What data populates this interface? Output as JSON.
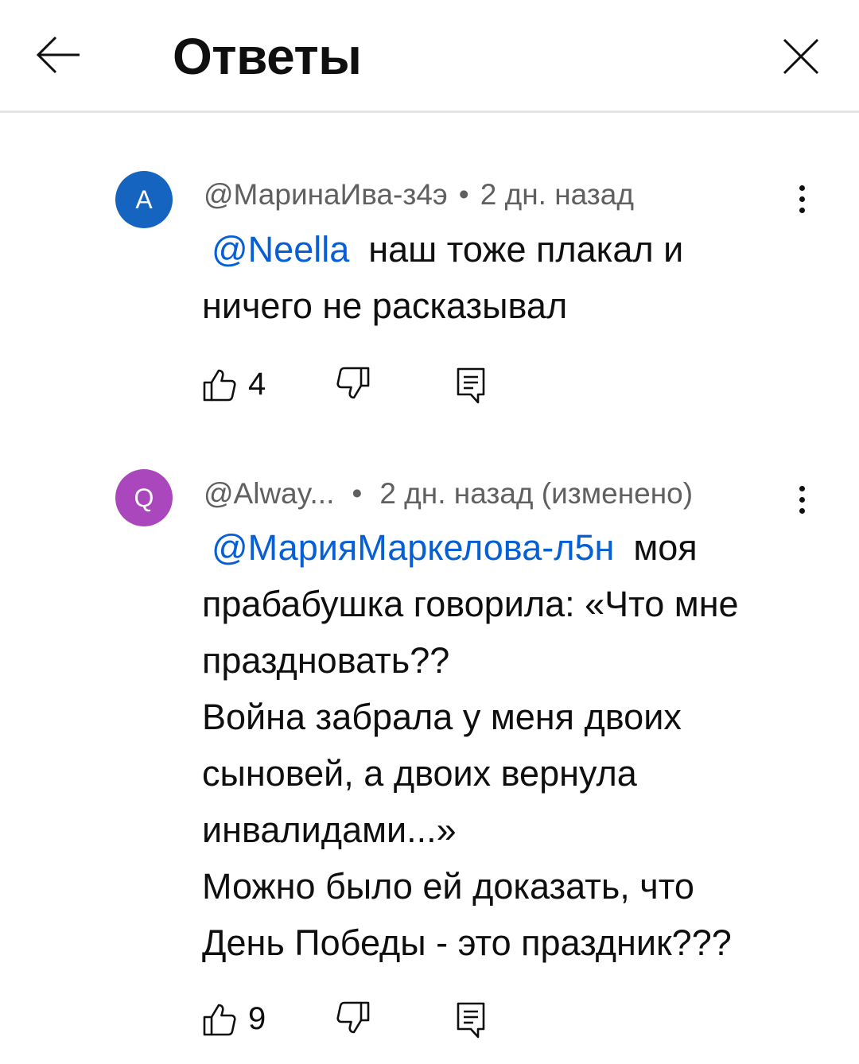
{
  "header": {
    "title": "Ответы"
  },
  "comments": [
    {
      "avatar_letter": "A",
      "avatar_color": "#1565c0",
      "author": "@МаринаИва-з4э",
      "time": "2 дн. назад",
      "mention": "@Neella",
      "text_lines": [
        "наш тоже плакал и",
        "ничего не расказывал"
      ],
      "likes": "4"
    },
    {
      "avatar_letter": "Q",
      "avatar_color": "#ab47bc",
      "author": "@Alway...",
      "time": "2 дн. назад (изменено)",
      "mention": "@МарияМаркелова-л5н",
      "text_lines": [
        "моя",
        "прабабушка говорила: «Что мне",
        "праздновать??",
        "Война забрала у меня двоих",
        "сыновей, а двоих вернула",
        "инвалидами...»",
        "Можно было ей доказать, что",
        "День Победы - это праздник???"
      ],
      "likes": "9"
    }
  ],
  "icons": {
    "back": "arrow-left-icon",
    "close": "close-icon",
    "more": "more-vertical-icon",
    "like": "thumb-up-icon",
    "dislike": "thumb-down-icon",
    "reply": "reply-comment-icon"
  },
  "colors": {
    "mention": "#065fd4",
    "meta": "#606060",
    "divider": "#e5e5e5"
  }
}
